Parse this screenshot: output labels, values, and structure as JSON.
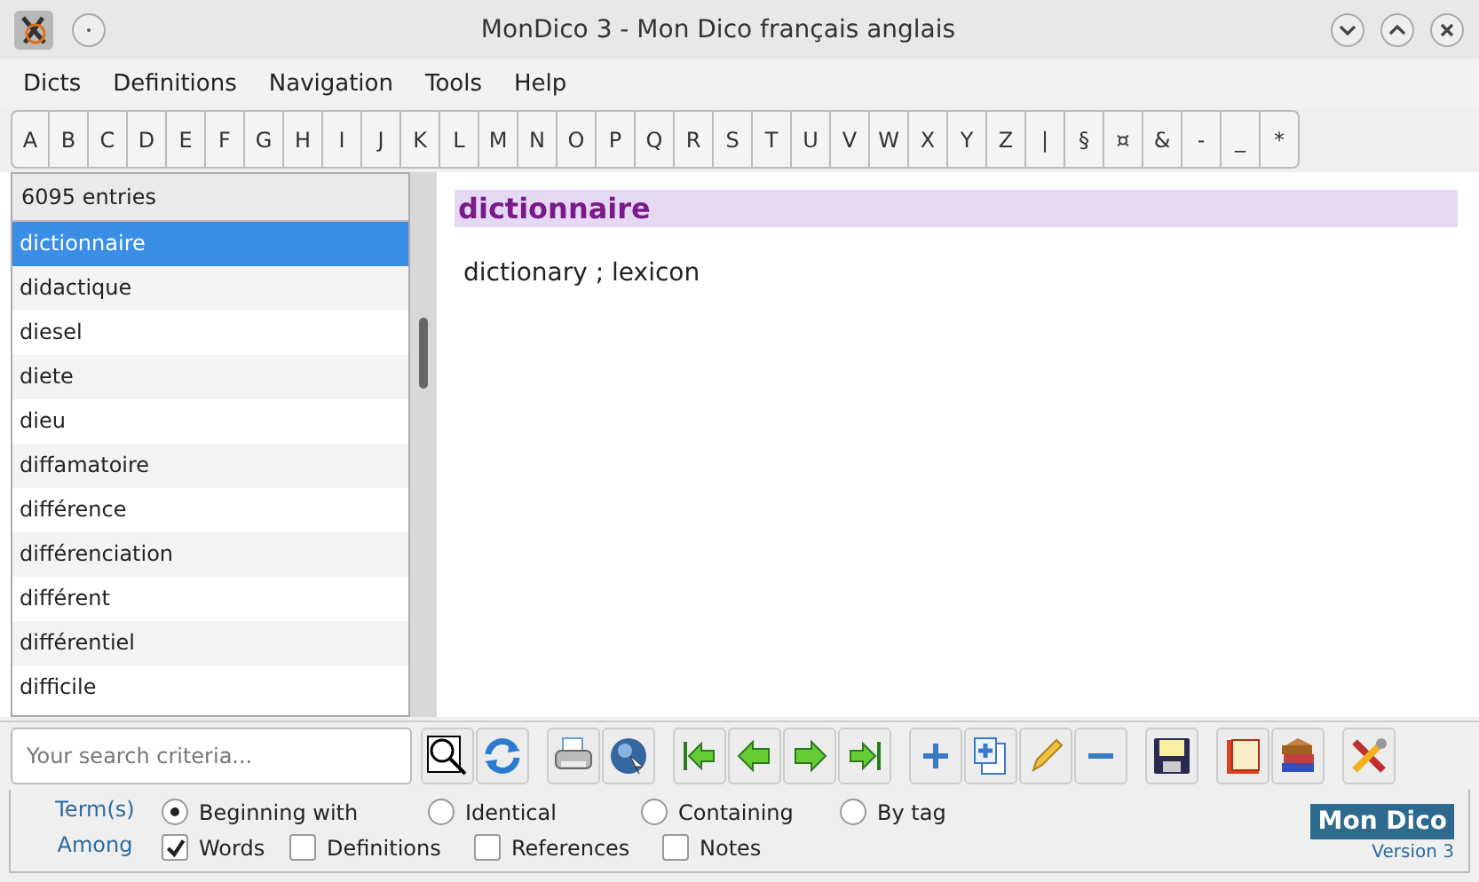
{
  "window": {
    "title": "MonDico 3 - Mon Dico français anglais"
  },
  "menu": [
    "Dicts",
    "Definitions",
    "Navigation",
    "Tools",
    "Help"
  ],
  "alphabet": [
    "A",
    "B",
    "C",
    "D",
    "E",
    "F",
    "G",
    "H",
    "I",
    "J",
    "K",
    "L",
    "M",
    "N",
    "O",
    "P",
    "Q",
    "R",
    "S",
    "T",
    "U",
    "V",
    "W",
    "X",
    "Y",
    "Z",
    "|",
    "§",
    "¤",
    "&",
    "-",
    "_",
    "*"
  ],
  "list": {
    "header": "6095 entries",
    "entries": [
      {
        "word": "dictionnaire",
        "selected": true
      },
      {
        "word": "didactique",
        "selected": false
      },
      {
        "word": "diesel",
        "selected": false
      },
      {
        "word": "diete",
        "selected": false
      },
      {
        "word": "dieu",
        "selected": false
      },
      {
        "word": "diffamatoire",
        "selected": false
      },
      {
        "word": "différence",
        "selected": false
      },
      {
        "word": "différenciation",
        "selected": false
      },
      {
        "word": "différent",
        "selected": false
      },
      {
        "word": "différentiel",
        "selected": false
      },
      {
        "word": "difficile",
        "selected": false
      }
    ]
  },
  "definition": {
    "headword": "dictionnaire",
    "text": "dictionary ; lexicon"
  },
  "search": {
    "placeholder": "Your search criteria..."
  },
  "toolbar": [
    {
      "kind": "search"
    },
    {
      "kind": "refresh"
    },
    {
      "kind": "print"
    },
    {
      "kind": "globe"
    },
    {
      "kind": "first"
    },
    {
      "kind": "prev"
    },
    {
      "kind": "next"
    },
    {
      "kind": "last"
    },
    {
      "kind": "add"
    },
    {
      "kind": "copy"
    },
    {
      "kind": "edit"
    },
    {
      "kind": "remove"
    },
    {
      "kind": "save"
    },
    {
      "kind": "book"
    },
    {
      "kind": "books"
    },
    {
      "kind": "tools"
    }
  ],
  "terms": {
    "label": "Term(s)",
    "options": [
      {
        "label": "Beginning with",
        "selected": true
      },
      {
        "label": "Identical",
        "selected": false
      },
      {
        "label": "Containing",
        "selected": false
      },
      {
        "label": "By tag",
        "selected": false
      }
    ]
  },
  "among": {
    "label": "Among",
    "options": [
      {
        "label": "Words",
        "checked": true
      },
      {
        "label": "Definitions",
        "checked": false
      },
      {
        "label": "References",
        "checked": false
      },
      {
        "label": "Notes",
        "checked": false
      }
    ]
  },
  "logo": {
    "name": "Mon Dico",
    "version": "Version 3"
  }
}
